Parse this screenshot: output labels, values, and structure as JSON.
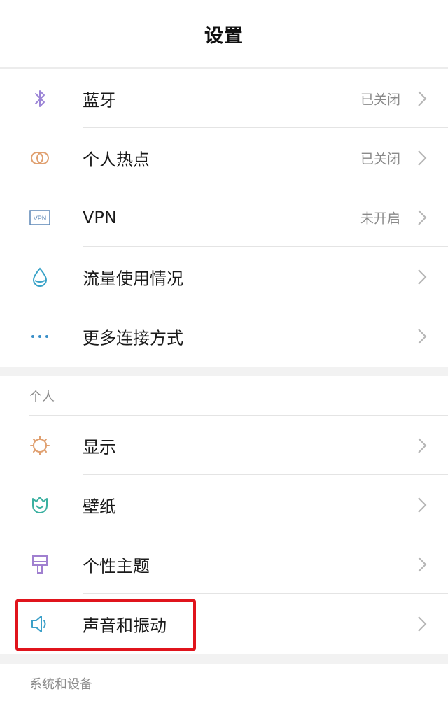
{
  "header": {
    "title": "设置"
  },
  "network": {
    "items": [
      {
        "label": "蓝牙",
        "status": "已关闭",
        "icon": "bluetooth-icon",
        "color": "#9b84d6"
      },
      {
        "label": "个人热点",
        "status": "已关闭",
        "icon": "hotspot-icon",
        "color": "#e0a070"
      },
      {
        "label": "VPN",
        "status": "未开启",
        "icon": "vpn-icon",
        "color": "#5b86b6"
      },
      {
        "label": "流量使用情况",
        "status": "",
        "icon": "data-usage-icon",
        "color": "#3aa3c8"
      },
      {
        "label": "更多连接方式",
        "status": "",
        "icon": "more-dots-icon",
        "color": "#3a8fc8"
      }
    ]
  },
  "personal": {
    "header": "个人",
    "items": [
      {
        "label": "显示",
        "icon": "display-sun-icon",
        "color": "#e0a070"
      },
      {
        "label": "壁纸",
        "icon": "wallpaper-tulip-icon",
        "color": "#3ab0a0"
      },
      {
        "label": "个性主题",
        "icon": "theme-brush-icon",
        "color": "#a080d0"
      },
      {
        "label": "声音和振动",
        "icon": "speaker-icon",
        "color": "#3a9fc8"
      }
    ]
  },
  "system": {
    "header": "系统和设备"
  },
  "vpn_badge": "VPN",
  "highlight_color": "#e0141c"
}
